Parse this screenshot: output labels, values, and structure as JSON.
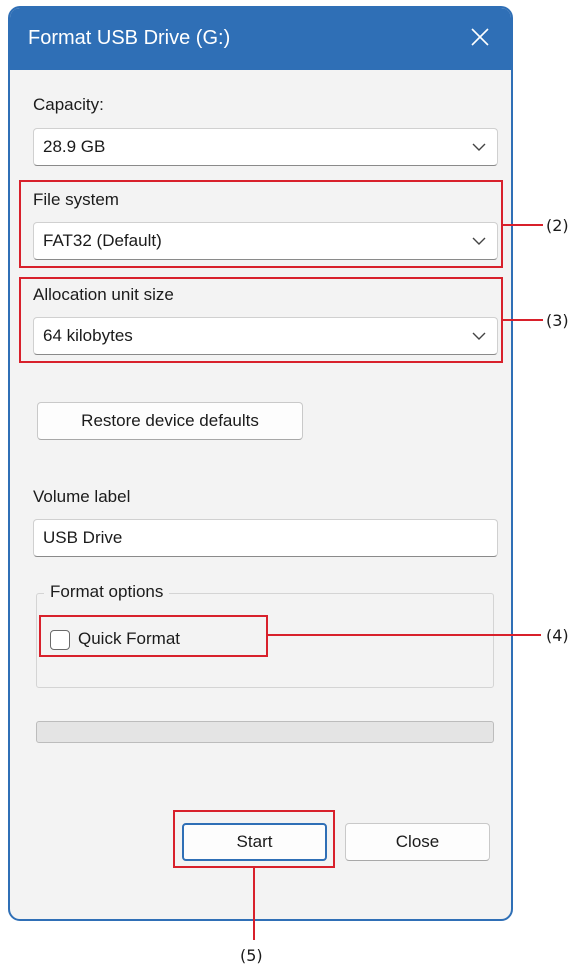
{
  "window": {
    "title": "Format USB Drive (G:)"
  },
  "capacity": {
    "label": "Capacity:",
    "value": "28.9 GB"
  },
  "file_system": {
    "label": "File system",
    "value": "FAT32 (Default)"
  },
  "allocation": {
    "label": "Allocation unit size",
    "value": "64 kilobytes"
  },
  "restore_button": {
    "label": "Restore device defaults"
  },
  "volume": {
    "label": "Volume label",
    "value": "USB Drive"
  },
  "format_options": {
    "legend": "Format options",
    "quick_format_label": "Quick Format",
    "quick_format_checked": false
  },
  "progress": {
    "fraction": 0
  },
  "buttons": {
    "start": "Start",
    "close": "Close"
  },
  "annotations": {
    "file_system": "(2)",
    "allocation": "(3)",
    "quick_format": "(4)",
    "start": "(5)"
  },
  "colors": {
    "title_bar": "#2f6fb6",
    "callout": "#d8202b",
    "dialog_bg": "#f3f3f3"
  },
  "icons": {
    "close": "close-icon",
    "dropdown": "chevron-down-icon"
  }
}
